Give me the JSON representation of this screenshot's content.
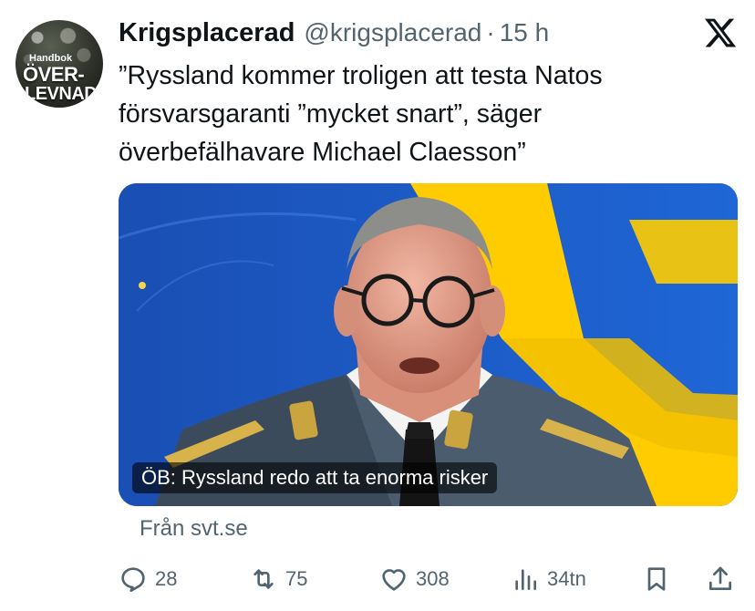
{
  "author": {
    "name": "Krigsplacerad",
    "handle": "@krigsplacerad",
    "separator": "·",
    "time": "15 h",
    "avatar_text_small": "Handbok",
    "avatar_text_big": "ÖVER-",
    "avatar_text_big2": "LEVNAD"
  },
  "tweet": {
    "text": "”Ryssland kommer troligen att testa Natos försvarsgaranti ”mycket snart”, säger överbefälhavare Michael Claesson”"
  },
  "card": {
    "caption": "ÖB: Ryssland redo att ta enorma risker",
    "source": "Från svt.se"
  },
  "actions": {
    "replies": "28",
    "reposts": "75",
    "likes": "308",
    "views": "34tn"
  },
  "icons": {
    "platform": "x-logo-icon",
    "reply": "reply-icon",
    "repost": "repost-icon",
    "like": "heart-icon",
    "views": "views-icon",
    "bookmark": "bookmark-icon",
    "share": "share-icon"
  },
  "colors": {
    "text": "#0f1419",
    "muted": "#536471",
    "flag_blue": "#1e5fc8",
    "flag_yellow": "#fecc00"
  }
}
